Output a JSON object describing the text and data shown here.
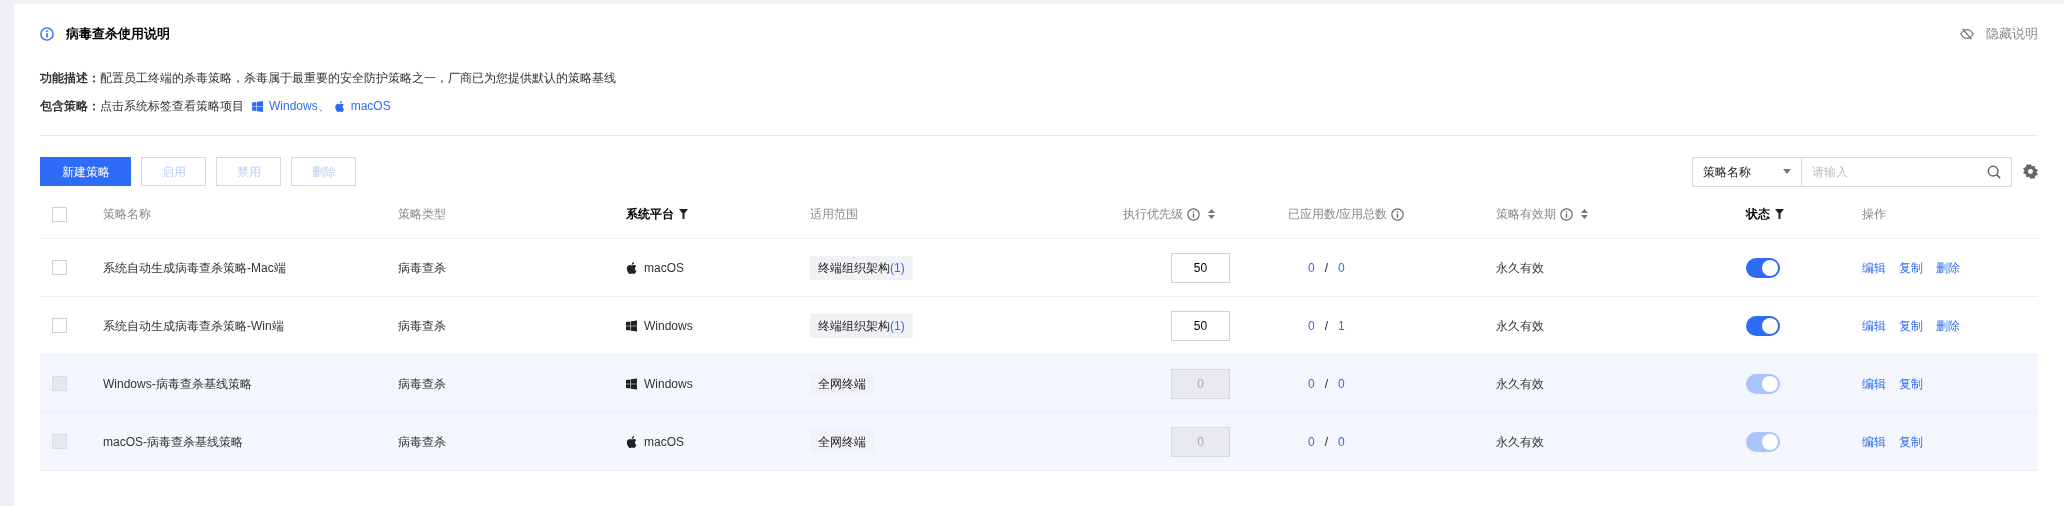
{
  "notice": {
    "title": "病毒查杀使用说明",
    "hide_label": "隐藏说明",
    "description_label": "功能描述：",
    "description": "配置员工终端的杀毒策略，杀毒属于最重要的安全防护策略之一，厂商已为您提供默认的策略基线",
    "policies_label": "包含策略：",
    "policies_text": "点击系统标签查看策略项目",
    "policy_links": [
      {
        "kind": "windows",
        "label": "Windows、"
      },
      {
        "kind": "apple",
        "label": "macOS"
      }
    ]
  },
  "toolbar": {
    "buttons": [
      {
        "label": "新建策略",
        "kind": "primary",
        "disabled": false
      },
      {
        "label": "启用",
        "kind": "default",
        "disabled": true
      },
      {
        "label": "禁用",
        "kind": "default",
        "disabled": true
      },
      {
        "label": "删除",
        "kind": "default",
        "disabled": true
      }
    ],
    "search": {
      "field_select": "策略名称",
      "placeholder": "请输入"
    }
  },
  "table": {
    "header_checked": false,
    "separator": "/",
    "columns": [
      {
        "label": "策略名称",
        "filter_active": false
      },
      {
        "label": "策略类型",
        "filter_active": false
      },
      {
        "label": "系统平台",
        "filter_active": true
      },
      {
        "label": "适用范围",
        "filter_active": false
      },
      {
        "label": "执行优先级",
        "filter_active": false
      },
      {
        "label": "已应用数/应用总数",
        "filter_active": false
      },
      {
        "label": "策略有效期",
        "filter_active": false
      },
      {
        "label": "状态",
        "filter_active": true
      },
      {
        "label": "操作",
        "filter_active": false
      }
    ],
    "rows": [
      {
        "checked": false,
        "disabled": false,
        "name": "系统自动生成病毒查杀策略-Mac端",
        "type": "病毒查杀",
        "platform": {
          "kind": "apple",
          "label": "macOS"
        },
        "scope": {
          "label": "终端组织架构",
          "count": "(1)"
        },
        "priority": "50",
        "applied": "0",
        "total": "0",
        "validity": "永久有效",
        "on": true,
        "actions": [
          "编辑",
          "复制",
          "删除"
        ]
      },
      {
        "checked": false,
        "disabled": false,
        "name": "系统自动生成病毒查杀策略-Win端",
        "type": "病毒查杀",
        "platform": {
          "kind": "windows",
          "label": "Windows"
        },
        "scope": {
          "label": "终端组织架构",
          "count": "(1)"
        },
        "priority": "50",
        "applied": "0",
        "total": "1",
        "validity": "永久有效",
        "on": true,
        "actions": [
          "编辑",
          "复制",
          "删除"
        ]
      },
      {
        "checked": false,
        "disabled": true,
        "name": "Windows-病毒查杀基线策略",
        "type": "病毒查杀",
        "platform": {
          "kind": "windows",
          "label": "Windows"
        },
        "scope": {
          "label": "全网终端"
        },
        "priority": "0",
        "applied": "0",
        "total": "0",
        "validity": "永久有效",
        "on": true,
        "actions": [
          "编辑",
          "复制"
        ]
      },
      {
        "checked": false,
        "disabled": true,
        "name": "macOS-病毒查杀基线策略",
        "type": "病毒查杀",
        "platform": {
          "kind": "apple",
          "label": "macOS"
        },
        "scope": {
          "label": "全网终端"
        },
        "priority": "0",
        "applied": "0",
        "total": "0",
        "validity": "永久有效",
        "on": true,
        "actions": [
          "编辑",
          "复制"
        ]
      }
    ]
  }
}
